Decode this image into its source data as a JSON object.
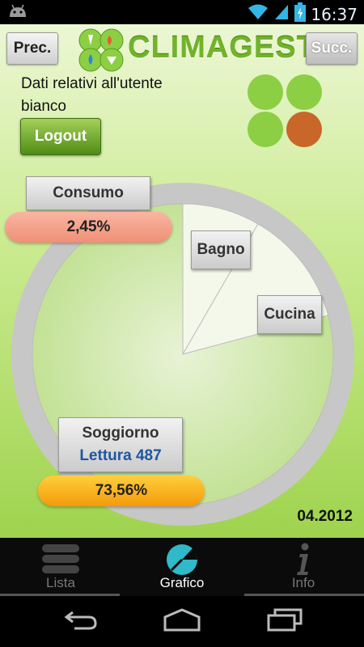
{
  "status_bar": {
    "time": "16:37"
  },
  "header": {
    "prev_label": "Prec.",
    "next_label": "Succ.",
    "app_name": "CLIMAGEST"
  },
  "user": {
    "info_line1": "Dati relativi all'utente",
    "info_line2": "bianco",
    "logout_label": "Logout"
  },
  "chart_data": {
    "type": "pie",
    "slices": [
      {
        "label": "Bagno",
        "share": 0.0833
      },
      {
        "label": "Cucina",
        "share": 0.125
      },
      {
        "label": "Soggiorno",
        "share": 0.7917
      }
    ],
    "consumo_label": "Consumo",
    "consumo_value": "2,45%",
    "soggiorno_reading": "Lettura 487",
    "soggiorno_value": "73,56%"
  },
  "date": "04.2012",
  "tabs": [
    {
      "label": "Lista",
      "icon": "list-icon",
      "active": false
    },
    {
      "label": "Grafico",
      "icon": "chart-icon",
      "active": true
    },
    {
      "label": "Info",
      "icon": "info-icon",
      "active": false
    }
  ],
  "colors": {
    "brand_green": "#72b32a",
    "consumo_pill": "#f08f76",
    "soggiorno_pill": "#f39a0a",
    "logo_orange": "#c9662a"
  }
}
